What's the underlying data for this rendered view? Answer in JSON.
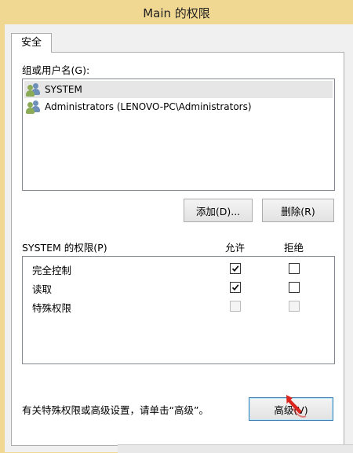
{
  "window": {
    "title": "Main 的权限"
  },
  "tab": {
    "label": "安全"
  },
  "groups": {
    "label": "组或用户名(G):",
    "items": [
      {
        "label": "SYSTEM",
        "selected": true,
        "icon": "users-icon"
      },
      {
        "label": "Administrators (LENOVO-PC\\Administrators)",
        "selected": false,
        "icon": "users-icon"
      }
    ]
  },
  "buttons": {
    "add": "添加(D)...",
    "remove": "删除(R)",
    "advanced": "高级(V)"
  },
  "permissions": {
    "label": "SYSTEM 的权限(P)",
    "allow_header": "允许",
    "deny_header": "拒绝",
    "rows": [
      {
        "name": "完全控制",
        "allow": true,
        "deny": false,
        "enabled": true
      },
      {
        "name": "读取",
        "allow": true,
        "deny": false,
        "enabled": true
      },
      {
        "name": "特殊权限",
        "allow": false,
        "deny": false,
        "enabled": false
      }
    ]
  },
  "advanced_hint": "有关特殊权限或高级设置，请单击“高级”。",
  "colors": {
    "titlebar": "#f0d893",
    "selected_item": "#e6e6e6",
    "arrow": "#d9251d"
  }
}
